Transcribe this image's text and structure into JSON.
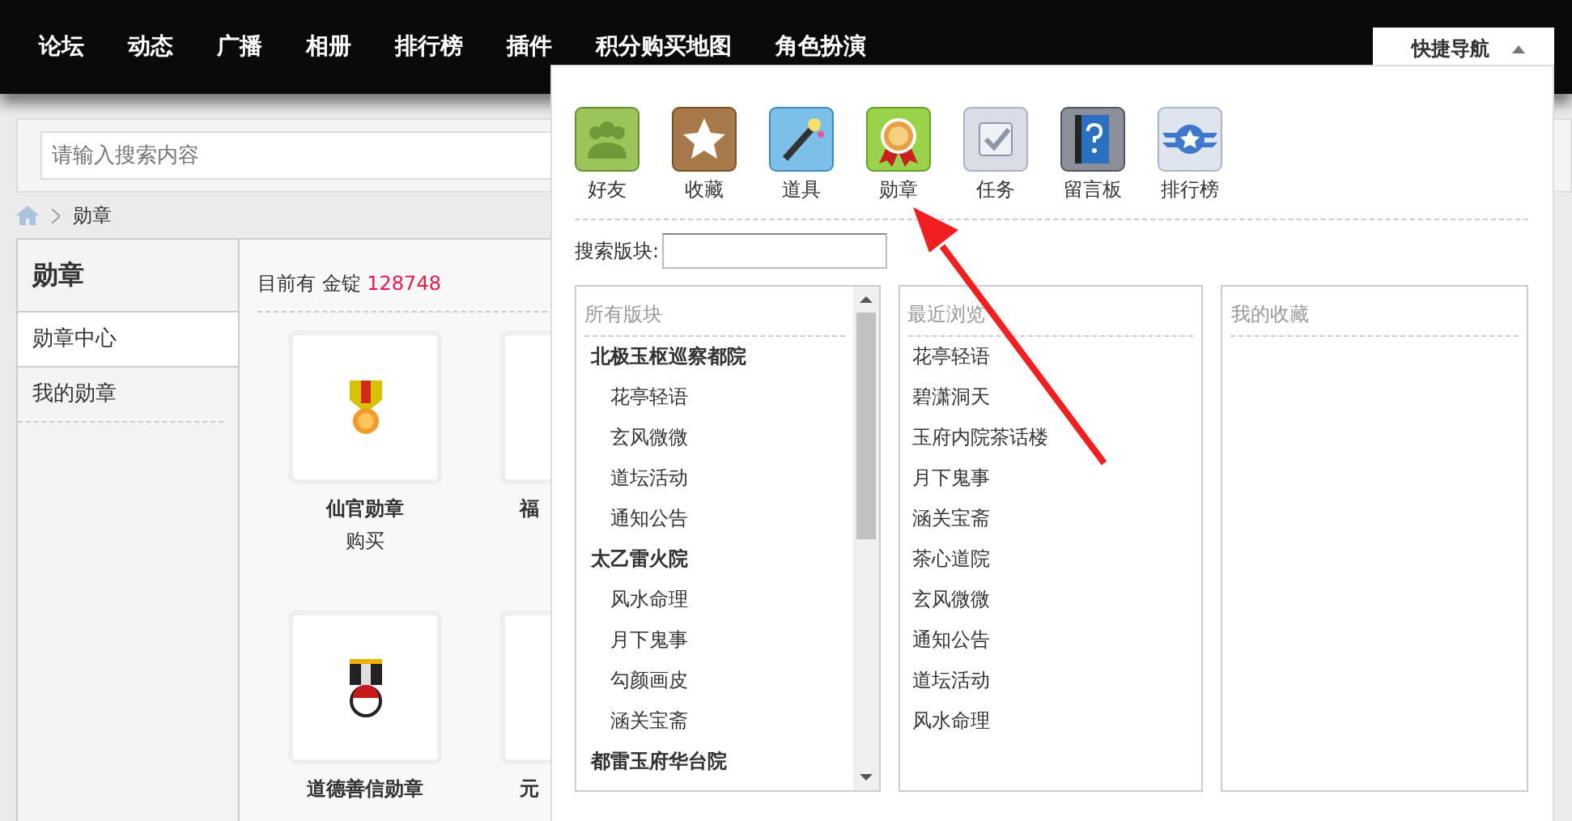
{
  "nav": {
    "items": [
      "论坛",
      "动态",
      "广播",
      "相册",
      "排行榜",
      "插件",
      "积分购买地图",
      "角色扮演"
    ]
  },
  "quick_nav": {
    "label": "快捷导航"
  },
  "search": {
    "placeholder": "请输入搜索内容"
  },
  "breadcrumb": {
    "current": "勋章"
  },
  "sidebar": {
    "title": "勋章",
    "items": [
      {
        "label": "勋章中心",
        "selected": true
      },
      {
        "label": "我的勋章",
        "selected": false
      }
    ]
  },
  "content": {
    "balance_label": "目前有 金锭",
    "balance": "128748",
    "medals": [
      {
        "name": "仙官勋章",
        "action": "购买",
        "kind": "sun"
      },
      {
        "name": "福",
        "kind": "covered"
      },
      {
        "name": "道德善信勋章",
        "kind": "red-disc"
      },
      {
        "name": "元",
        "kind": "covered"
      }
    ]
  },
  "quick_panel": {
    "apps": [
      {
        "label": "好友",
        "kind": "friends"
      },
      {
        "label": "收藏",
        "kind": "star"
      },
      {
        "label": "道具",
        "kind": "wand"
      },
      {
        "label": "勋章",
        "kind": "medal"
      },
      {
        "label": "任务",
        "kind": "task"
      },
      {
        "label": "留言板",
        "kind": "book"
      },
      {
        "label": "排行榜",
        "kind": "rank"
      }
    ],
    "forum_search": {
      "label": "搜索版块:"
    },
    "all_forums": {
      "title": "所有版块",
      "groups": [
        {
          "name": "北极玉枢巡察都院",
          "children": [
            {
              "name": "花亭轻语"
            },
            {
              "name": "玄风微微"
            },
            {
              "name": "道坛活动"
            },
            {
              "name": "通知公告"
            }
          ]
        },
        {
          "name": "太乙雷火院",
          "children": [
            {
              "name": "风水命理"
            },
            {
              "name": "月下鬼事"
            },
            {
              "name": "勾颜画皮"
            },
            {
              "name": "涵关宝斋"
            }
          ]
        },
        {
          "name": "都雷玉府华台院"
        }
      ]
    },
    "recent": {
      "title": "最近浏览",
      "items": [
        "花亭轻语",
        "碧潇洞天",
        "玉府内院茶话楼",
        "月下鬼事",
        "涵关宝斋",
        "茶心道院",
        "玄风微微",
        "通知公告",
        "道坛活动",
        "风水命理"
      ]
    },
    "favorites": {
      "title": "我的收藏"
    }
  }
}
